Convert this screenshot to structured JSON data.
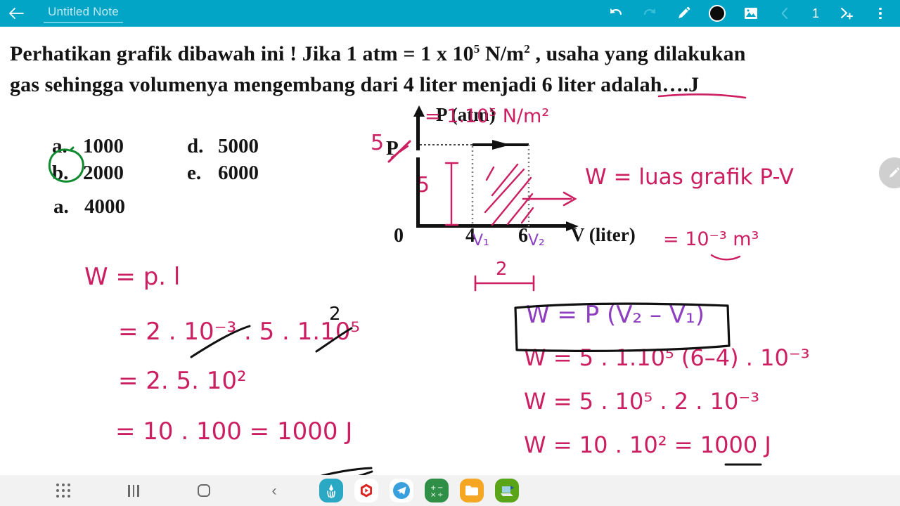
{
  "appbar": {
    "back_icon": "back-arrow-icon",
    "title": "Untitled Note",
    "undo_icon": "undo-icon",
    "redo_icon": "redo-icon",
    "pen_icon": "pencil-icon",
    "color_swatch": "color-swatch-black",
    "image_icon": "image-icon",
    "prev_page_icon": "chevron-left-icon",
    "page_number": "1",
    "add_page_icon": "add-page-icon",
    "overflow_icon": "more-vertical-icon",
    "bg_color": "#03a5c6",
    "title_color": "#bfe9f3"
  },
  "question": {
    "line1_a": "Perhatikan grafik dibawah ini ! Jika 1 atm = 1 x 10",
    "line1_sup": "5",
    "line1_b": " N/m",
    "line1_sup2": "2",
    "line1_c": " , usaha yang dilakukan",
    "line2": "gas sehingga volumenya mengembang dari 4 liter menjadi 6 liter adalah….J"
  },
  "options": [
    {
      "label": "a.",
      "value": "1000",
      "circled": true
    },
    {
      "label": "b.",
      "value": "2000",
      "circled": false
    },
    {
      "label": "a.",
      "value": "4000",
      "circled": false
    },
    {
      "label": "d.",
      "value": "5000",
      "circled": false
    },
    {
      "label": "e.",
      "value": "6000",
      "circled": false
    }
  ],
  "graph": {
    "y_axis_label": "P (atm)",
    "x_axis_label": "V (liter)",
    "origin_label": "0",
    "x_tick_1": "4",
    "x_tick_2": "6",
    "pressure_symbol": "P",
    "pressure_value_hw": "5",
    "height_annotation": "5",
    "v1_annotation": "V₁",
    "v2_annotation": "V₂",
    "width_annotation": "2",
    "p_unit_annotation": "= 1.10⁵ N/m²",
    "v_unit_annotation": "= 10⁻³ m³",
    "area_note": "W = luas grafik P-V"
  },
  "work_left": {
    "l1": "W = p. l",
    "l2": "= 2 . 10⁻³ .  5 . 1.10⁵",
    "l2_strike_sup": "2",
    "l3": "= 2. 5. 10²",
    "l4": "=  10 . 100   =   1000 J"
  },
  "work_right": {
    "boxed_formula": "W = P (V₂ – V₁)",
    "l1": "W = 5 . 1.10⁵ (6–4) . 10⁻³",
    "l2": "W = 5 . 10⁵ . 2 . 10⁻³",
    "l3": "W = 10 . 10²  =   1000 J"
  },
  "fab": {
    "icon": "edit-pencil-icon",
    "color": "#cfcfcf"
  },
  "sysbar": {
    "apps_grid_icon": "apps-grid-icon",
    "recents_icon": "recent-apps-icon",
    "home_icon": "home-icon",
    "back_icon": "back-nav-icon",
    "apps": [
      {
        "name": "squid-notes-app-icon",
        "color": "#2aa8c4"
      },
      {
        "name": "video-player-app-icon",
        "color": "#ffffff"
      },
      {
        "name": "telegram-app-icon",
        "color": "#ffffff"
      },
      {
        "name": "calculator-app-icon",
        "color": "#2f8f46"
      },
      {
        "name": "file-manager-app-icon",
        "color": "#f5a623"
      },
      {
        "name": "scanner-app-icon",
        "color": "#5aa417"
      }
    ]
  },
  "colors": {
    "pink_ink": "#cc1f62",
    "purple_ink": "#8e3fc0",
    "black_ink": "#101010",
    "green_circle": "#0f8a2e"
  }
}
